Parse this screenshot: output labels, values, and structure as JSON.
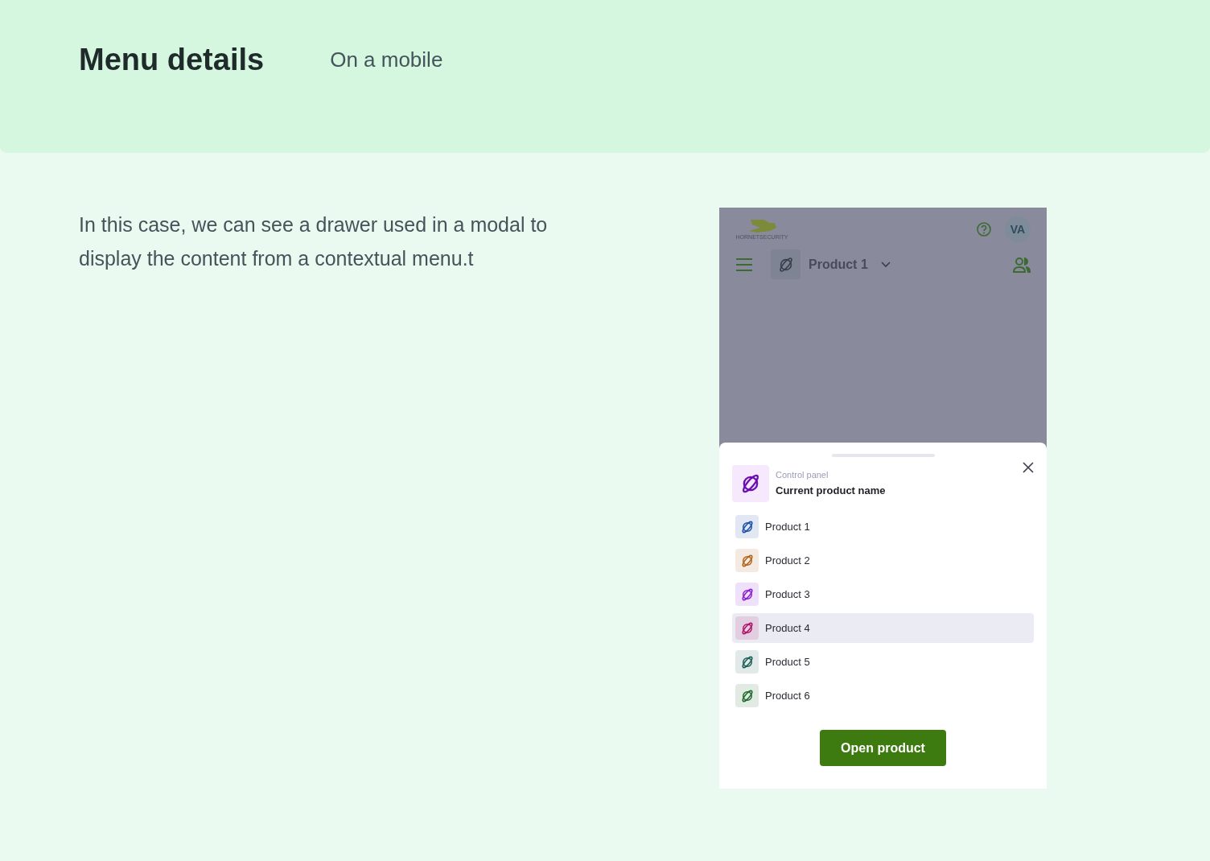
{
  "header": {
    "title": "Menu details",
    "subtitle": "On a mobile"
  },
  "description": "In this case, we can see a drawer used in a modal to display the content from a contextual menu.t",
  "phone": {
    "app_bar": {
      "logo_text": "HORNETSECURITY",
      "avatar": "VA",
      "current_product": "Product 1"
    },
    "drawer": {
      "eyebrow": "Control panel",
      "title": "Current product name",
      "products": [
        {
          "label": "Product 1",
          "color": "#1d4fa8",
          "selected": false
        },
        {
          "label": "Product 2",
          "color": "#b0641c",
          "selected": false
        },
        {
          "label": "Product 3",
          "color": "#8a1ed6",
          "selected": false
        },
        {
          "label": "Product 4",
          "color": "#b0136a",
          "selected": true
        },
        {
          "label": "Product 5",
          "color": "#1c5e57",
          "selected": false
        },
        {
          "label": "Product 6",
          "color": "#1f6a2c",
          "selected": false
        }
      ],
      "button": "Open product"
    }
  }
}
